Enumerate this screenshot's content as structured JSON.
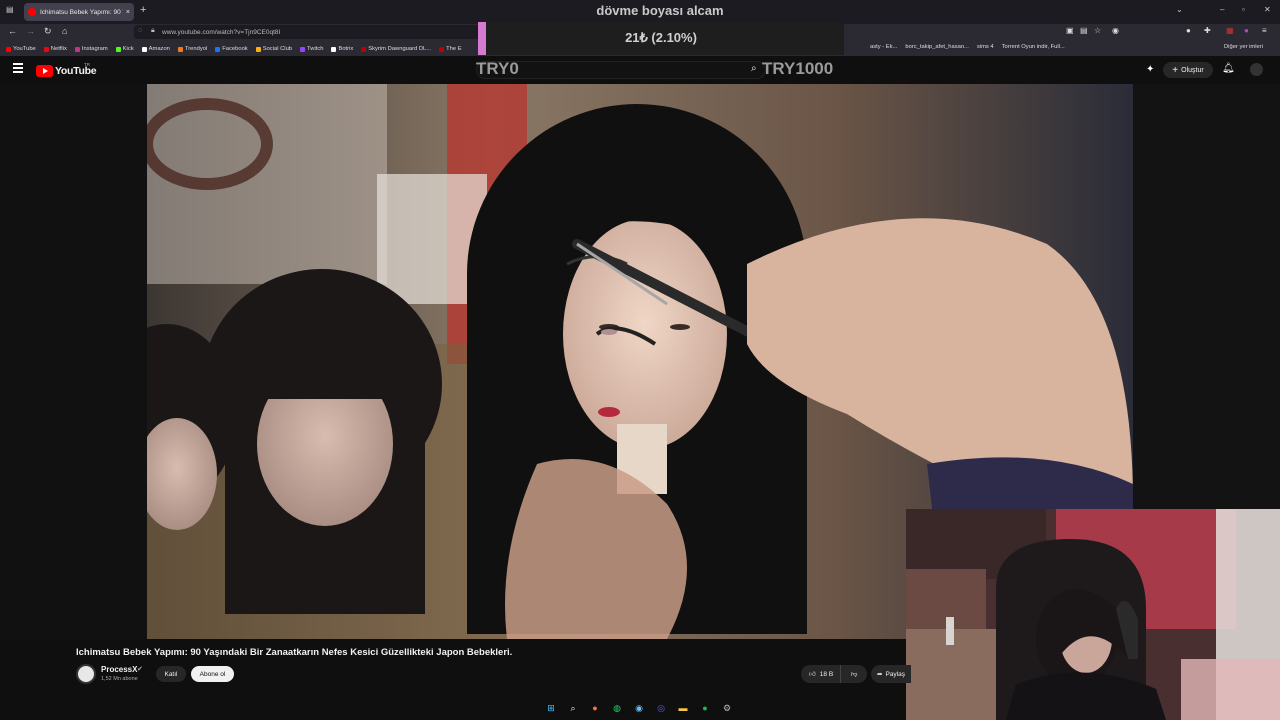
{
  "browser": {
    "tab_title": "Ichimatsu Bebek Yapımı: 90 Yaşı",
    "tab_close": "×",
    "new_tab": "+",
    "url": "www.youtube.com/watch?v=Tjn9CE0qt8I",
    "bookmarks": [
      {
        "label": "YouTube",
        "color": "#ff0000"
      },
      {
        "label": "Netflix",
        "color": "#e50914"
      },
      {
        "label": "Instagram",
        "color": "#c13584"
      },
      {
        "label": "Kick",
        "color": "#53fc18"
      },
      {
        "label": "Amazon",
        "color": "#ffffff"
      },
      {
        "label": "Trendyol",
        "color": "#f27a1a"
      },
      {
        "label": "Facebook",
        "color": "#1877f2"
      },
      {
        "label": "Social Club",
        "color": "#fcaf17"
      },
      {
        "label": "Twitch",
        "color": "#9146ff"
      },
      {
        "label": "Botrix",
        "color": "#ffffff"
      },
      {
        "label": "Skyrim Dawnguard DL...",
        "color": "#c00000"
      },
      {
        "label": "The E",
        "color": "#c00000"
      }
    ],
    "bookmarks_right": [
      "asty - Ek...",
      "borc_takip_afet_hasan...",
      "sims 4",
      "Torrent Oyun indir, Full..."
    ],
    "other_bookmarks": "Diğer yer imleri"
  },
  "stream_overlay": {
    "title": "dövme boyası alcam",
    "donation_text": "21₺ (2.10%)",
    "donation_progress": 0.021,
    "goal_start": "TRY0",
    "goal_end": "TRY1000"
  },
  "youtube": {
    "logo_text": "YouTube",
    "country_code": "TR",
    "create_label": "Oluştur"
  },
  "video": {
    "title": "Ichimatsu Bebek Yapımı: 90 Yaşındaki Bir Zanaatkarın Nefes Kesici Güzellikteki Japon Bebekleri.",
    "channel": "ProcessX",
    "subscribers": "1,52 Mn abone",
    "join_label": "Katıl",
    "subscribe_label": "Abone ol",
    "likes": "18 B",
    "share_label": "Paylaş"
  },
  "taskbar": {
    "icons": [
      "windows-icon",
      "search-icon",
      "firefox-icon",
      "whatsapp-icon",
      "steam-icon",
      "discord-icon",
      "file-explorer-icon",
      "spotify-icon",
      "settings-icon"
    ]
  }
}
